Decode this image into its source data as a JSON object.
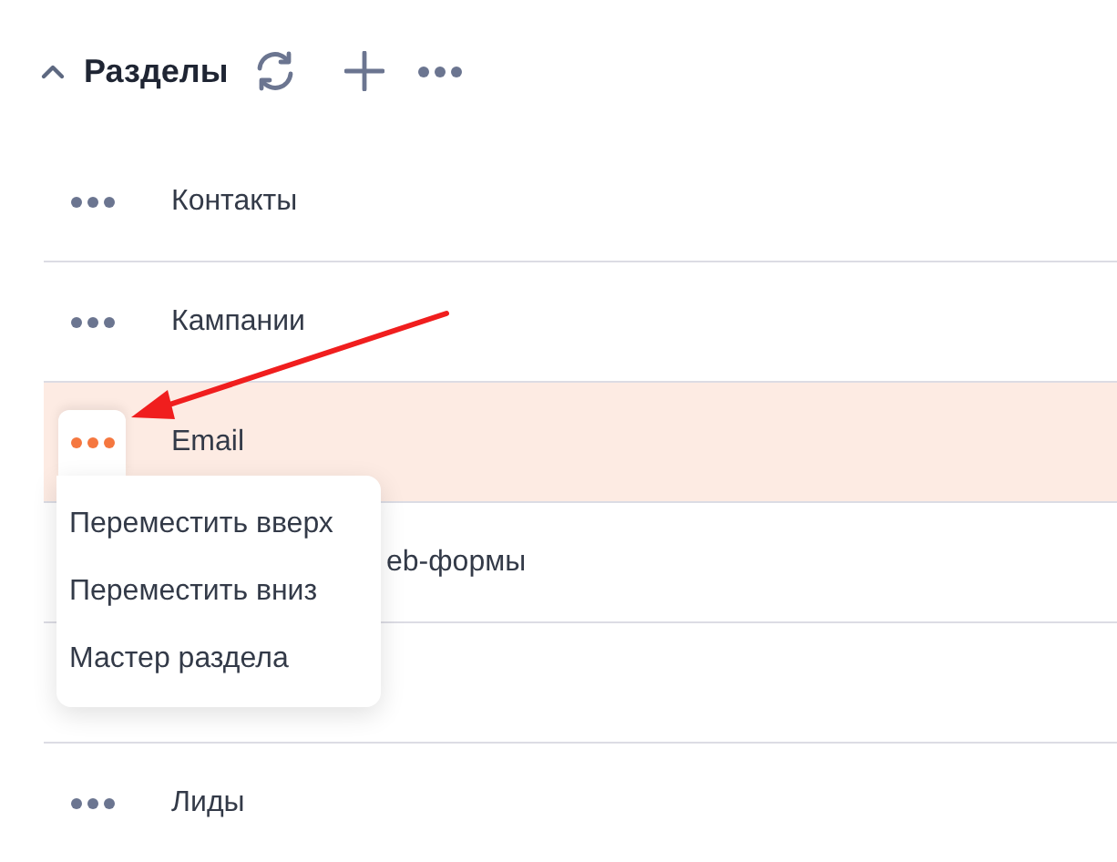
{
  "header": {
    "title": "Разделы",
    "expanded": true
  },
  "sections": [
    {
      "name": "Контакты",
      "kind": "full",
      "selected": false
    },
    {
      "name": "Кампании",
      "kind": "full",
      "selected": false
    },
    {
      "name": "Email",
      "kind": "full",
      "selected": true
    },
    {
      "name": "eb-формы",
      "kind": "partial",
      "selected": false
    },
    {
      "kind": "covered",
      "selected": false
    },
    {
      "name": "Лиды",
      "kind": "full",
      "selected": false
    }
  ],
  "menu": {
    "items": [
      "Переместить вверх",
      "Переместить вниз",
      "Мастер раздела"
    ]
  }
}
